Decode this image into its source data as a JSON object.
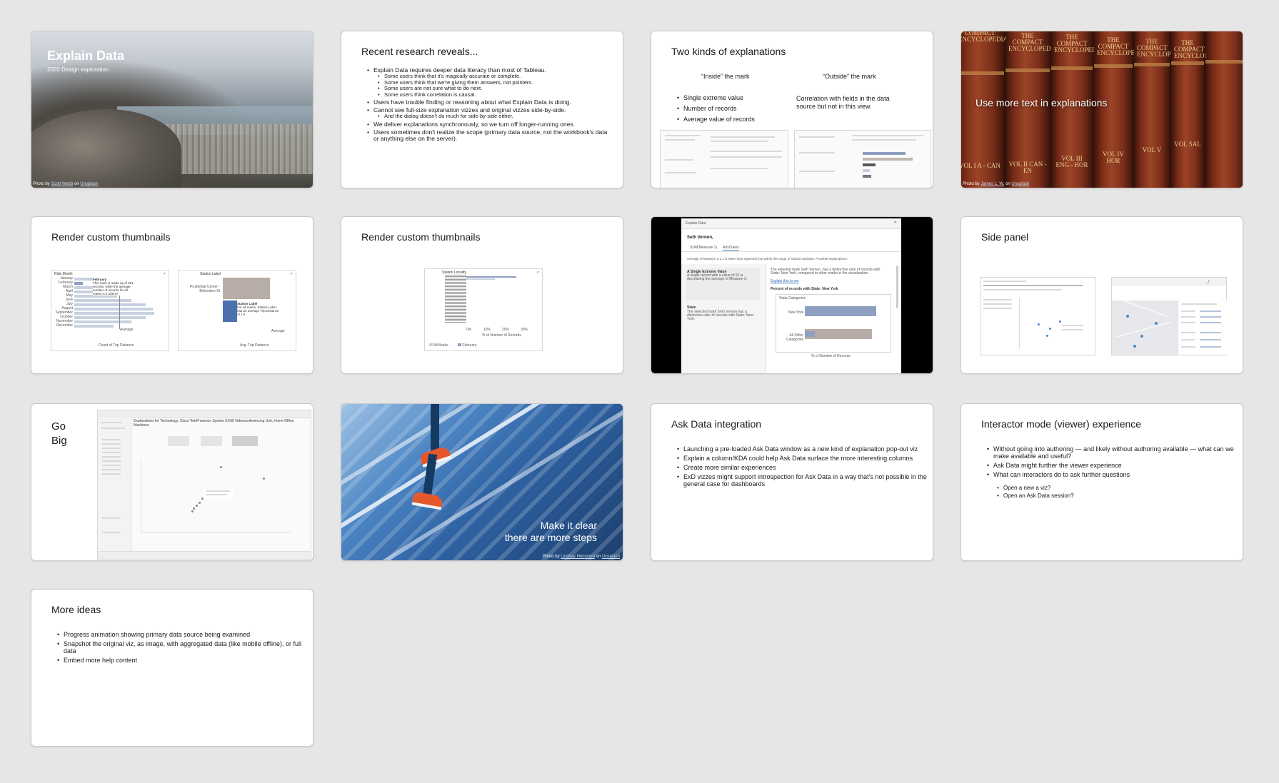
{
  "slides": {
    "s1": {
      "title": "Explain Data",
      "subtitle": "2020 Design exploration",
      "credit_prefix": "Photo by",
      "credit_author": "Scott Webb",
      "credit_on": "on",
      "credit_site": "Unsplash"
    },
    "s2": {
      "title": "Recent research reveals...",
      "bullets": [
        "Explain Data requires deeper data literacy than most of Tableau.",
        "Some users think that it's magically accurate or complete.",
        "Some users think that we're giving them answers, not pointers.",
        "Some users are not sure what to do next.",
        "Some users think correlation is causal.",
        "Users have trouble finding or reasoning about what Explain Data is doing.",
        "Cannot see full-size explanation vizzes and original vizzes side-by-side.",
        "And the dialog doesn't do much for side-by-side either.",
        "We deliver explanations synchronously, so we turn off longer-running ones.",
        "Users sometimes don't realize the scope (primary data source, not the workbook's data or anything else on the server)."
      ]
    },
    "s3": {
      "title": "Two kinds of explanations",
      "inside_heading": "“Inside” the mark",
      "outside_heading": "“Outside” the mark",
      "inside_bullets": [
        "Single extreme value",
        "Number of records",
        "Average value of records"
      ],
      "outside_text": "Correlation with fields in the data source but not in this view."
    },
    "s4": {
      "text": "Use more text in explanations",
      "credit_prefix": "Photo by",
      "credit_author": "James L. W.",
      "credit_on": "on",
      "credit_site": "Unsplash",
      "spines": [
        "COMPACT ENCYCLOPEDIA",
        "THE COMPACT ENCYCLOPEDIA",
        "THE COMPACT ENCYCLOPEDIA",
        "THE COMPACT ENCYCLOPEDIA",
        "THE COMPACT ENCYCLOPEDIA",
        "THE COMPACT ENCYCLOPEDIA"
      ],
      "vols": [
        "VOL I A - CAN",
        "VOL II CAN - EN",
        "VOL III ENG - HOR",
        "VOL IV HOR",
        "VOL V",
        "VOL SAL"
      ]
    },
    "s5": {
      "title": "Render custom thumbnails",
      "panel1_title": "Ride Month",
      "months": [
        "January",
        "February",
        "March",
        "April",
        "May",
        "June",
        "July",
        "August",
        "September",
        "October",
        "November",
        "December"
      ],
      "tooltip_title": "February",
      "tooltip_text": "This mark is made up of 651 records, while the average number of records for all marks is 4,188.67.",
      "axis1_label": "Count of Trip Distance",
      "average_label": "Average",
      "panel2_title": "Station Label",
      "panel2_row1": "Prudential Center - Belvedere St",
      "panel2_tooltip_title": "Station Label",
      "panel2_tooltip_text": "For all marks, Station Label has an average Trip Distance of 1.6.",
      "axis2_label": "Avg. Trip Distance"
    },
    "s6": {
      "title": "Render custom thumbnails",
      "panel_title": "Station Locality",
      "axis_label": "% of Number of Records",
      "legend_all": "All Marks",
      "legend_feb": "February",
      "ticks": [
        "0%",
        "10%",
        "20%",
        "30%"
      ]
    },
    "s7": {
      "window_title": "Explain Data",
      "heading": "Seth Vernon,",
      "tab1": "SUM(Measure 1)",
      "tab2": "Arts/Sales",
      "summary": "Average of Measure 2.1.1 is lower than expected, but within the range of natural variation. Possible explanations:",
      "item1_title": "A Single Extreme Value",
      "item1_text": "A single record with a value of 91 is decreasing the average of Measure 2.",
      "item2_title": "State",
      "item2_text": "The selected mark Seth Vernon has a distinctive ratio of records with State: New York.",
      "right_text": "The selected mark Seth Vernon, has a distinctive ratio of records with State: New York, compared to other marks in the visualization.",
      "right_link": "Explain this to me",
      "chart_title": "Percent of records with State: New York",
      "chart_panel_title": "State Categories",
      "row1": "New York",
      "row2": "All Other Categories",
      "axis_label": "% of Number of Records"
    },
    "s8": {
      "title": "Side panel"
    },
    "s9": {
      "title_line1": "Go",
      "title_line2": "Big",
      "explanations_title": "Explanations for Technology, Cisco TelePresence System EX90 Videoconferencing Unit, Home Office, Machines"
    },
    "s10": {
      "line1": "Make it clear",
      "line2": "there are more steps",
      "credit_prefix": "Photo by",
      "credit_author": "Lindsay Henwood",
      "credit_on": "on",
      "credit_site": "Unsplash"
    },
    "s11": {
      "title": "Ask Data integration",
      "bullets": [
        "Launching a pre-loaded Ask Data window as a new kind of explanation pop-out viz",
        "Explain a column/KDA could help Ask Data surface the more interesting columns",
        "Create more similar experiences",
        "ExD vizzes might support introspection for Ask Data in a way that's not possible in the general case for dashboards"
      ]
    },
    "s12": {
      "title": "Interactor mode (viewer) experience",
      "bullets": [
        "Without going into authoring — and likely without authoring available — what can we make available and useful?",
        "Ask Data might further the viewer experience",
        "What can interactors do to ask further questions"
      ],
      "sub_bullets": [
        "Open a new a viz?",
        "Open an Ask Data session?"
      ]
    },
    "s13": {
      "title": "More ideas",
      "bullets": [
        "Progress animation showing primary data source being examined",
        "Snapshot the original viz, as image, with aggregated data (like mobile offline), or full data",
        "Embed more help content"
      ]
    }
  },
  "colors": {
    "background": "#e6e6e6",
    "slide_border": "#c9c9c9",
    "bar_light": "#c7d0e0",
    "bar_dark": "#8e9fc0",
    "accent_blue": "#4d86c4",
    "shoe_orange": "#e4582c",
    "book_leather": "#7a2c18"
  }
}
